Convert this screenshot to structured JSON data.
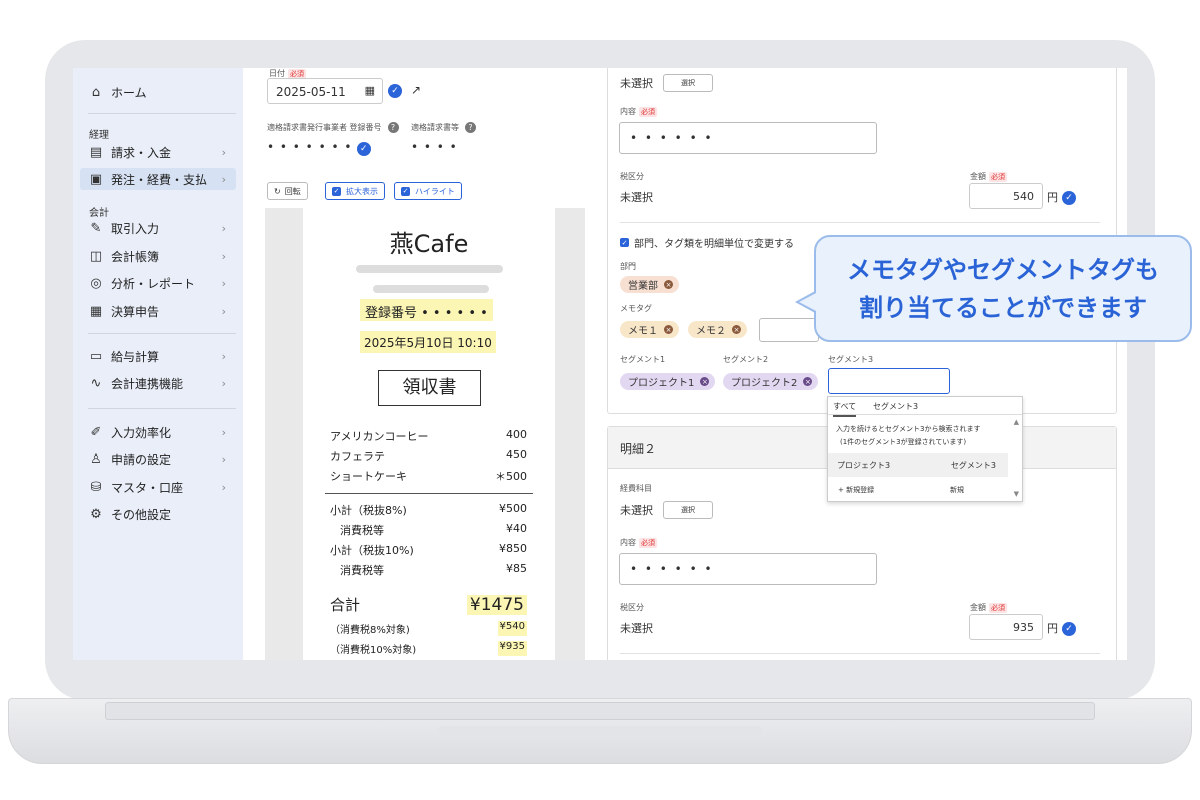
{
  "sidebar": {
    "home": "ホーム",
    "section_keiri": "経理",
    "invoice": "請求・入金",
    "order": "発注・経費・支払",
    "section_kaikei": "会計",
    "transaction": "取引入力",
    "ledger": "会計帳簿",
    "analysis": "分析・レポート",
    "settlement": "決算申告",
    "payroll": "給与計算",
    "accounting_link": "会計連携機能",
    "efficiency": "入力効率化",
    "application": "申請の設定",
    "master": "マスタ・口座",
    "other": "その他設定"
  },
  "receipt_panel": {
    "date_label": "日付",
    "required": "必須",
    "date_value": "2025-05-11",
    "reg_label": "適格請求書発行事業者 登録番号",
    "reg_value": "• • • • • • •",
    "inv_label": "適格請求書等",
    "inv_value": "• • • •",
    "btn_rotate": "回転",
    "btn_zoom": "拡大表示",
    "btn_highlight": "ハイライト"
  },
  "receipt": {
    "shop": "燕Cafe",
    "reg": "登録番号 • • • • • •",
    "datetime": "2025年5月10日 10:10",
    "title": "領収書",
    "items": [
      {
        "name": "アメリカンコーヒー",
        "price": "400"
      },
      {
        "name": "カフェラテ",
        "price": "450"
      },
      {
        "name": "ショートケーキ",
        "price": "＊500"
      }
    ],
    "subtotal8_label": "小計（税抜8%)",
    "subtotal8": "¥500",
    "tax8_label": "消費税等",
    "tax8": "¥40",
    "subtotal10_label": "小計（税抜10%)",
    "subtotal10": "¥850",
    "tax10_label": "消費税等",
    "tax10": "¥85",
    "total_label": "合計",
    "total": "¥1475",
    "target8_label": "（消費税8%対象)",
    "target8": "¥540",
    "target10_label": "（消費税10%対象)",
    "target10": "¥935"
  },
  "form": {
    "unselected": "未選択",
    "select_btn": "選択",
    "content_label": "内容",
    "required": "必須",
    "content_value": "• • • • • •",
    "tax_label": "税区分",
    "amount_label": "金額",
    "amount1": "540",
    "yen": "円",
    "per_line_check": "部門、タグ類を明細単位で変更する",
    "dept_label": "部門",
    "dept_tag": "営業部",
    "memo_label": "メモタグ",
    "memo1": "メモ１",
    "memo2": "メモ２",
    "seg1_label": "セグメント1",
    "seg2_label": "セグメント2",
    "seg3_label": "セグメント3",
    "seg1_tag": "プロジェクト1",
    "seg2_tag": "プロジェクト2",
    "detail2_title": "明細２",
    "account_label": "経費科目",
    "amount2": "935"
  },
  "dropdown": {
    "tab_all": "すべて",
    "tab_seg3": "セグメント3",
    "hint1": "入力を続けるとセグメント3から検索されます",
    "hint2": "(1件のセグメント3が登録されています)",
    "opt_name": "プロジェクト3",
    "opt_type": "セグメント3",
    "new_label": "+ 新規登録",
    "new_type": "新規"
  },
  "callout": {
    "line1": "メモタグやセグメントタグも",
    "line2": "割り当てることができます"
  }
}
